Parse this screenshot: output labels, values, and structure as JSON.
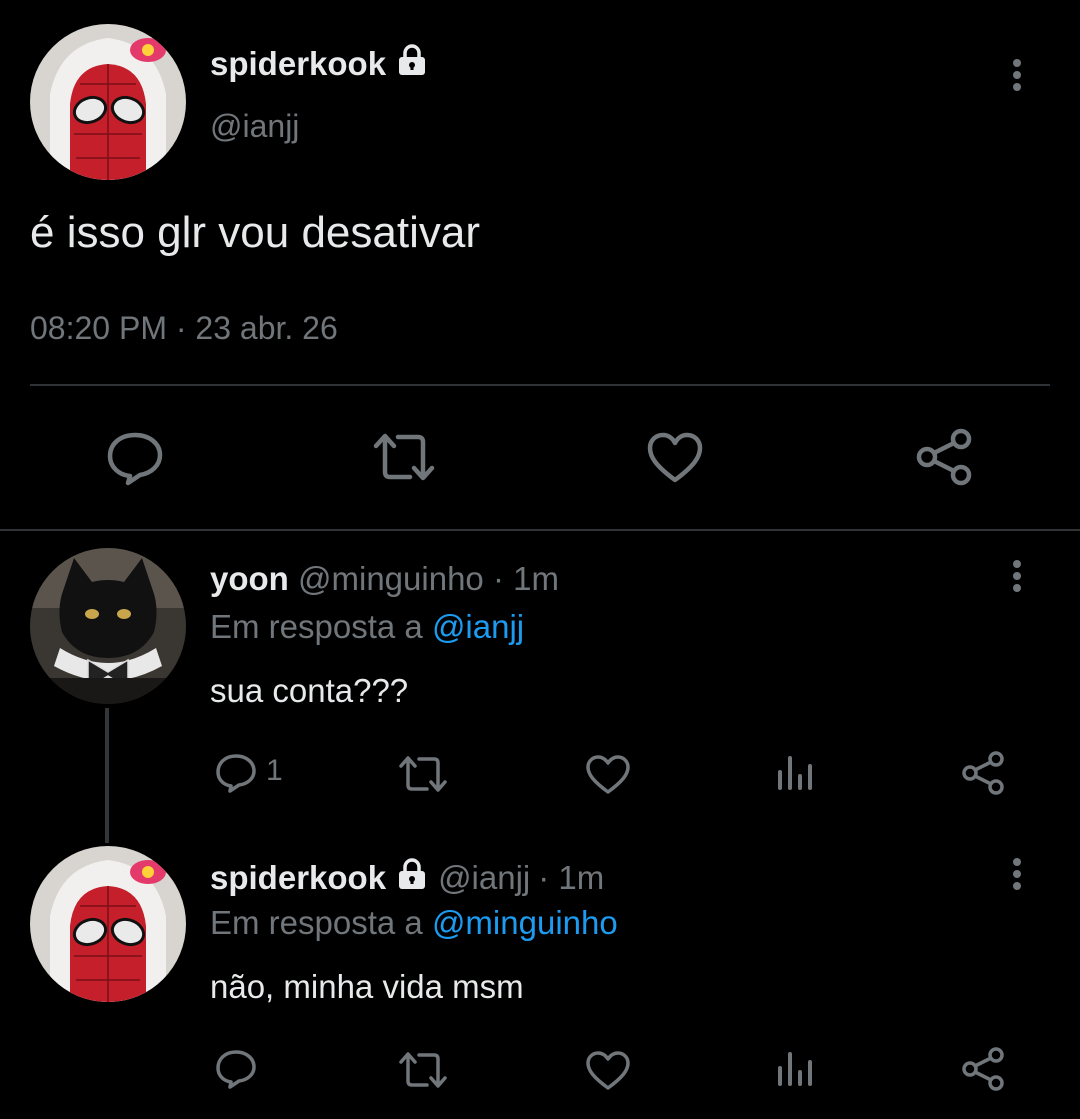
{
  "main_tweet": {
    "display_name": "spiderkook",
    "handle": "@ianjj",
    "text": "é isso glr vou desativar",
    "timestamp": "08:20 PM · 23 abr. 26",
    "avatar": "spiderman-hello-kitty-avatar",
    "actions": [
      "reply-icon",
      "retweet-icon",
      "like-icon",
      "share-icon"
    ]
  },
  "replies": [
    {
      "display_name": "yoon",
      "handle": "@minguinho",
      "time": "· 1m",
      "reply_prefix": "Em resposta a",
      "reply_to": "@ianjj",
      "text": "sua conta???",
      "reply_count": "1",
      "avatar": "black-cat-avatar",
      "actions": [
        "reply-icon",
        "retweet-icon",
        "like-icon",
        "views-icon",
        "share-icon"
      ]
    },
    {
      "display_name": "spiderkook",
      "handle": "@ianjj",
      "time": "· 1m",
      "reply_prefix": "Em resposta a",
      "reply_to": "@minguinho",
      "text": "não, minha vida msm",
      "reply_count": "",
      "avatar": "spiderman-hello-kitty-avatar",
      "actions": [
        "reply-icon",
        "retweet-icon",
        "like-icon",
        "views-icon",
        "share-icon"
      ]
    }
  ],
  "colors": {
    "background": "#000000",
    "text": "#e7e9ea",
    "secondary": "#71767b",
    "link": "#1d9bf0",
    "divider": "#2f3336"
  }
}
